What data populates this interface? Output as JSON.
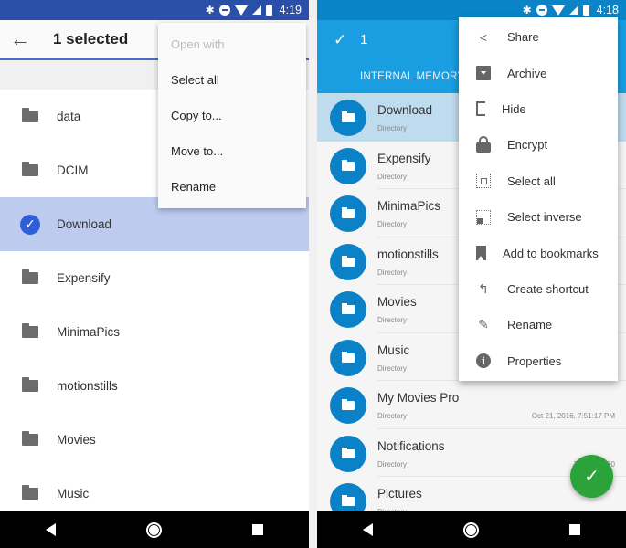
{
  "left_screen": {
    "status_bar": {
      "time": "4:19",
      "color": "#2a4fa8"
    },
    "app_bar": {
      "back_icon": "arrow-left-icon",
      "title": "1 selected"
    },
    "overflow_menu": [
      {
        "label": "Open with",
        "enabled": false
      },
      {
        "label": "Select all",
        "enabled": true
      },
      {
        "label": "Copy to...",
        "enabled": true
      },
      {
        "label": "Move to...",
        "enabled": true
      },
      {
        "label": "Rename",
        "enabled": true
      }
    ],
    "files": [
      {
        "name": "data",
        "selected": false
      },
      {
        "name": "DCIM",
        "selected": false
      },
      {
        "name": "Download",
        "selected": true
      },
      {
        "name": "Expensify",
        "selected": false
      },
      {
        "name": "MinimaPics",
        "selected": false
      },
      {
        "name": "motionstills",
        "selected": false
      },
      {
        "name": "Movies",
        "selected": false
      },
      {
        "name": "Music",
        "selected": false
      }
    ],
    "selected_color": "#bccbee"
  },
  "right_screen": {
    "status_bar": {
      "time": "4:18",
      "color": "#0a84c6"
    },
    "app_bar": {
      "check_icon": "check-icon",
      "count": "1",
      "tab": "INTERNAL MEMORY",
      "color": "#1a9ee2"
    },
    "overflow_menu": [
      {
        "label": "Share",
        "icon": "share-icon"
      },
      {
        "label": "Archive",
        "icon": "archive-icon"
      },
      {
        "label": "Hide",
        "icon": "hide-icon"
      },
      {
        "label": "Encrypt",
        "icon": "lock-icon"
      },
      {
        "label": "Select all",
        "icon": "select-all-icon"
      },
      {
        "label": "Select inverse",
        "icon": "select-inverse-icon"
      },
      {
        "label": "Add to bookmarks",
        "icon": "bookmark-icon"
      },
      {
        "label": "Create shortcut",
        "icon": "shortcut-icon"
      },
      {
        "label": "Rename",
        "icon": "pencil-icon"
      },
      {
        "label": "Properties",
        "icon": "info-icon"
      }
    ],
    "files": [
      {
        "name": "Download",
        "type": "Directory",
        "date": "",
        "selected": true
      },
      {
        "name": "Expensify",
        "type": "Directory",
        "date": "",
        "selected": false
      },
      {
        "name": "MinimaPics",
        "type": "Directory",
        "date": "",
        "selected": false
      },
      {
        "name": "motionstills",
        "type": "Directory",
        "date": "",
        "selected": false
      },
      {
        "name": "Movies",
        "type": "Directory",
        "date": "",
        "selected": false
      },
      {
        "name": "Music",
        "type": "Directory",
        "date": "",
        "selected": false
      },
      {
        "name": "My Movies Pro",
        "type": "Directory",
        "date": "Oct 21, 2016, 7:51:17 PM",
        "selected": false
      },
      {
        "name": "Notifications",
        "type": "Directory",
        "date": "Jan 19, 1970",
        "selected": false
      },
      {
        "name": "Pictures",
        "type": "Directory",
        "date": "",
        "selected": false
      }
    ],
    "fab": {
      "icon": "check-icon",
      "color": "#2ba23a"
    }
  },
  "nav_bar": {
    "back": "back-triangle-icon",
    "home": "home-circle-icon",
    "recents": "recents-square-icon"
  }
}
